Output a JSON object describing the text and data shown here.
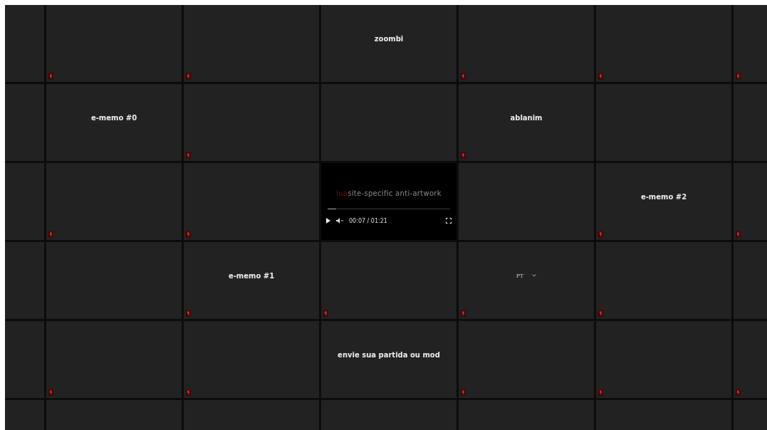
{
  "rows": [
    {
      "tiles": [
        {
          "kind": "blank",
          "marker": false
        },
        {
          "kind": "blank",
          "marker": true
        },
        {
          "kind": "blank",
          "marker": true
        },
        {
          "kind": "label",
          "label": "zoombi",
          "marker": false
        },
        {
          "kind": "blank",
          "marker": true
        },
        {
          "kind": "blank",
          "marker": true
        },
        {
          "kind": "blank",
          "marker": true
        }
      ]
    },
    {
      "tiles": [
        {
          "kind": "blank",
          "marker": false
        },
        {
          "kind": "label",
          "label": "e-memo #0",
          "marker": false
        },
        {
          "kind": "blank",
          "marker": true
        },
        {
          "kind": "blank",
          "marker": false
        },
        {
          "kind": "label",
          "label": "ablanim",
          "marker": true
        },
        {
          "kind": "blank",
          "marker": false
        },
        {
          "kind": "blank",
          "marker": false
        }
      ]
    },
    {
      "tiles": [
        {
          "kind": "blank",
          "marker": false
        },
        {
          "kind": "blank",
          "marker": true
        },
        {
          "kind": "blank",
          "marker": true
        },
        {
          "kind": "video",
          "title_prefix": "lua",
          "title": "site-specific anti-artwork",
          "time": "00:07 / 01:21",
          "level": 0.07,
          "marker": false
        },
        {
          "kind": "blank",
          "marker": false
        },
        {
          "kind": "label",
          "label": "e-memo #2",
          "marker": true
        },
        {
          "kind": "blank",
          "marker": true
        }
      ]
    },
    {
      "tiles": [
        {
          "kind": "blank",
          "marker": false
        },
        {
          "kind": "blank",
          "marker": false
        },
        {
          "kind": "label",
          "label": "e-memo #1",
          "marker": true
        },
        {
          "kind": "blank",
          "marker": true
        },
        {
          "kind": "language",
          "label": "PT",
          "marker": true
        },
        {
          "kind": "blank",
          "marker": true
        },
        {
          "kind": "blank",
          "marker": false
        }
      ]
    },
    {
      "tiles": [
        {
          "kind": "blank",
          "marker": false
        },
        {
          "kind": "blank",
          "marker": true
        },
        {
          "kind": "blank",
          "marker": true
        },
        {
          "kind": "label",
          "label": "envie sua partida ou mod",
          "marker": false
        },
        {
          "kind": "blank",
          "marker": true
        },
        {
          "kind": "blank",
          "marker": true
        },
        {
          "kind": "blank",
          "marker": true
        }
      ]
    },
    {
      "tiles": [
        {
          "kind": "blank",
          "marker": false
        },
        {
          "kind": "blank",
          "marker": false
        },
        {
          "kind": "blank",
          "marker": false
        },
        {
          "kind": "blank",
          "marker": false
        },
        {
          "kind": "blank",
          "marker": false
        },
        {
          "kind": "blank",
          "marker": false
        },
        {
          "kind": "blank",
          "marker": false
        }
      ]
    }
  ]
}
